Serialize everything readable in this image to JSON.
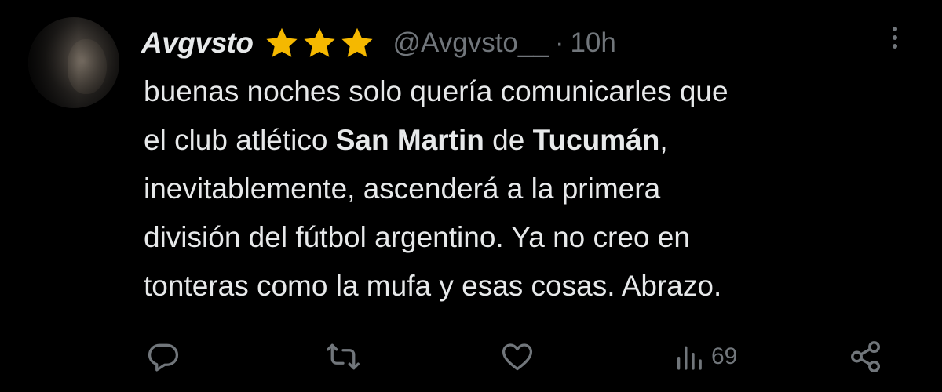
{
  "tweet": {
    "author": {
      "display_name": "Avgvsto",
      "badges": [
        "star-icon",
        "star-icon",
        "star-icon"
      ],
      "handle": "@Avgvsto__",
      "separator": "·",
      "time": "10h"
    },
    "body": {
      "line1": "buenas noches solo quería comunicarles que",
      "line2_a": "el club atlético ",
      "line2_b": "San Martin",
      "line2_c": " de ",
      "line2_d": "Tucumán",
      "line2_e": ",",
      "line3": "inevitablemente, ascenderá a la primera",
      "line4": "división del fútbol argentino. Ya no creo en",
      "line5": "tonteras como la mufa y esas cosas. Abrazo."
    },
    "actions": {
      "reply_icon": "reply-icon",
      "retweet_icon": "retweet-icon",
      "like_icon": "heart-icon",
      "views_icon": "views-icon",
      "views_count": "69",
      "share_icon": "share-icon"
    },
    "colors": {
      "background": "#000000",
      "text": "#e7e9ea",
      "muted": "#71767b",
      "star": "#f5b800"
    }
  }
}
